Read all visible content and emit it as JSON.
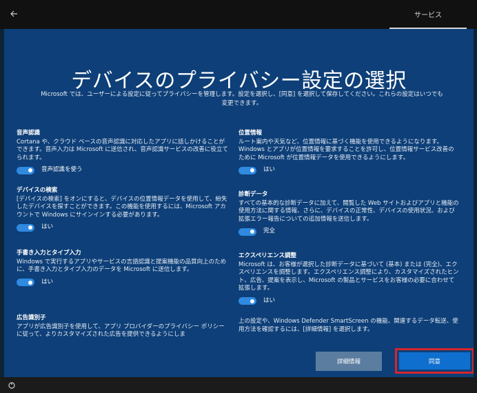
{
  "topbar": {
    "tab_label": "サービス"
  },
  "title": "デバイスのプライバシー設定の選択",
  "subtitle": "Microsoft では、ユーザーによる設定に従ってプライバシーを管理します。設定を選択し、[同意] を選択して保存してください。これらの設定はいつでも変更できます。",
  "left": {
    "speech": {
      "heading": "音声認識",
      "body": "Cortana や、クラウド ベースの音声認識に対応したアプリに話しかけることができます。音声入力は Microsoft に送信され、音声認識サービスの改善に役立てられます。",
      "toggle_label": "音声認識を使う",
      "toggle_on": true
    },
    "find_device": {
      "heading": "デバイスの検索",
      "body": "[デバイスの検索] をオンにすると、デバイスの位置情報データを使用して、紛失したデバイスを探すことができます。この機能を使用するには、Microsoft アカウントで Windows にサインインする必要があります。",
      "toggle_label": "はい",
      "toggle_on": true
    },
    "inking": {
      "heading": "手書き入力とタイプ入力",
      "body": "Windows で実行するアプリやサービスの言語認識と提案機能の品質向上のために、手書き入力とタイプ入力のデータを Microsoft に送信します。",
      "toggle_label": "はい",
      "toggle_on": true
    },
    "ad_id": {
      "heading": "広告識別子",
      "body": "アプリが広告識別子を使用して、アプリ プロバイダーのプライバシー ポリシーに従って、よりカスタマイズされた広告を提供できるようにしま"
    }
  },
  "right": {
    "location": {
      "heading": "位置情報",
      "body": "ルート案内や天気など、位置情報に基づく機能を使用できるようになります。Windows とアプリが位置情報を要求することを許可し、位置情報サービス改善のために Microsoft が位置情報データを使用できるようにします。",
      "toggle_label": "はい",
      "toggle_on": true
    },
    "diagnostics": {
      "heading": "診断データ",
      "body": "すべての基本的な診断データに加えて、閲覧した Web サイトおよびアプリと機能の使用方法に関する情報、さらに、デバイスの正常性、デバイスの使用状況、および拡張エラー報告についての追加情報を送信します。",
      "toggle_label": "完全",
      "toggle_on": true
    },
    "experience": {
      "heading": "エクスペリエンス調整",
      "body": "Microsoft は、お客様が選択した診断データに基づいて (基本) または (完全)、エクスペリエンスを調整します。エクスペリエンス調整により、カスタマイズされたヒント、広告、提案を表示し、Microsoft の製品とサービスをお客様の必要に合わせて拡張します。",
      "toggle_label": "はい",
      "toggle_on": true
    },
    "note": "上の設定や、Windows Defender SmartScreen の機能、関連するデータ転送、使用方法を確認するには、[詳細情報] を選択します。"
  },
  "buttons": {
    "details": "詳細情報",
    "agree": "同意"
  },
  "icons": {
    "back": "back-arrow-icon",
    "accessibility": "ease-of-access-icon"
  },
  "colors": {
    "background": "#0e3f78",
    "toggle_on": "#2f8ae0",
    "agree_button": "#0f6fcf",
    "highlight_border": "#d6252d"
  }
}
